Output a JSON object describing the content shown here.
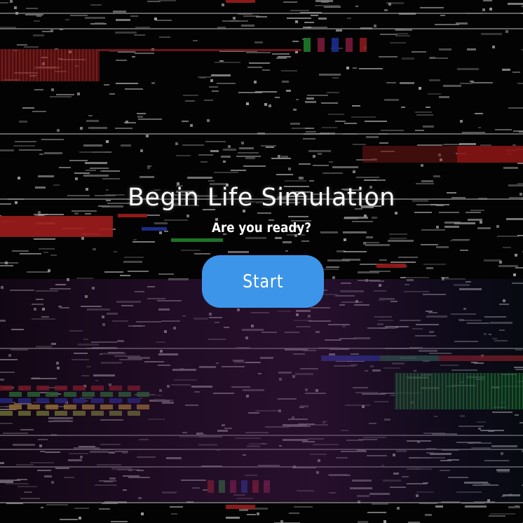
{
  "title": "Begin Life Simulation",
  "subtitle": "Are you ready?",
  "start_button": {
    "label": "Start",
    "color": "#3d95ea"
  },
  "background": {
    "base_color": "#030303",
    "glitch_colors": [
      "#8b1a1a",
      "#1f7a2a",
      "#1c2d8f",
      "#b08a2a",
      "#7a3a8a"
    ]
  }
}
